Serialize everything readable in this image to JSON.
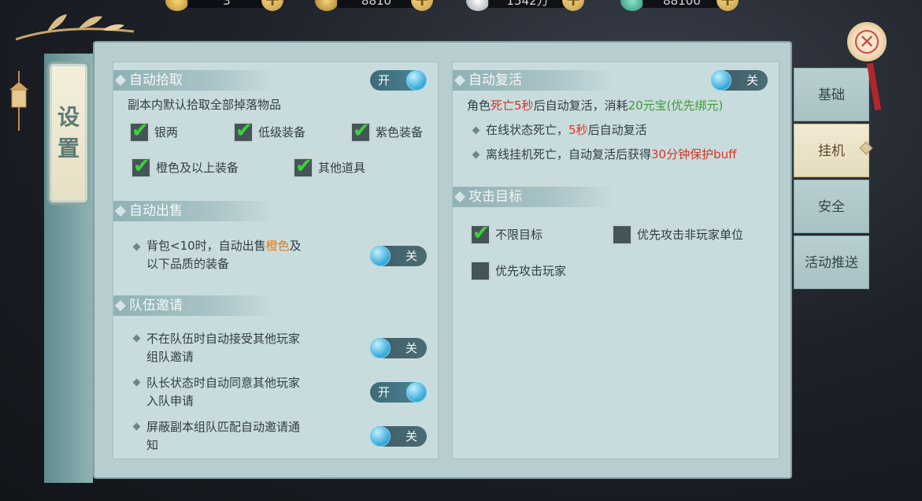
{
  "currencies": [
    {
      "name": "gold-ingot-icon",
      "value": "3"
    },
    {
      "name": "gold-bag-icon",
      "value": "8810"
    },
    {
      "name": "silver-icon",
      "value": "1542万"
    },
    {
      "name": "jade-icon",
      "value": "88100"
    }
  ],
  "title": {
    "char1": "设",
    "char2": "置"
  },
  "left": {
    "auto_pickup": {
      "title": "自动拾取",
      "toggle": "开",
      "desc": "副本内默认拾取全部掉落物品",
      "options": [
        "银两",
        "低级装备",
        "紫色装备",
        "橙色及以上装备",
        "其他道具"
      ]
    },
    "auto_sell": {
      "title": "自动出售",
      "line1_a": "背包<10时，自动出售",
      "line1_b": "橙色",
      "line1_c": "及",
      "line2": "以下品质的装备",
      "toggle": "关"
    },
    "team_invite": {
      "title": "队伍邀请",
      "items": [
        {
          "line1": "不在队伍时自动接受其他玩家",
          "line2": "组队邀请",
          "toggle": "关"
        },
        {
          "line1": "队长状态时自动同意其他玩家",
          "line2": "入队申请",
          "toggle": "开"
        },
        {
          "line1": "屏蔽副本组队匹配自动邀请通",
          "line2": "知",
          "toggle": "关"
        }
      ]
    }
  },
  "right": {
    "auto_revive": {
      "title": "自动复活",
      "toggle": "关",
      "l1_a": "角色",
      "l1_b": "死亡5秒",
      "l1_c": "后自动复活，消耗",
      "l1_d": "20元宝(优先绑元)",
      "l2_a": "在线状态死亡，",
      "l2_b": "5秒",
      "l2_c": "后自动复活",
      "l3_a": "离线挂机死亡，自动复活后获得",
      "l3_b": "30分钟保护buff"
    },
    "attack_target": {
      "title": "攻击目标",
      "options": [
        "不限目标",
        "优先攻击非玩家单位",
        "优先攻击玩家"
      ]
    }
  },
  "tabs": [
    "基础",
    "挂机",
    "安全",
    "活动推送"
  ],
  "colors": {
    "toggle_knob": "#34a7d8",
    "check": "#3fd13a",
    "red_text": "#d3342b",
    "green_text": "#3e9a35",
    "orange_text": "#e07b1a"
  }
}
